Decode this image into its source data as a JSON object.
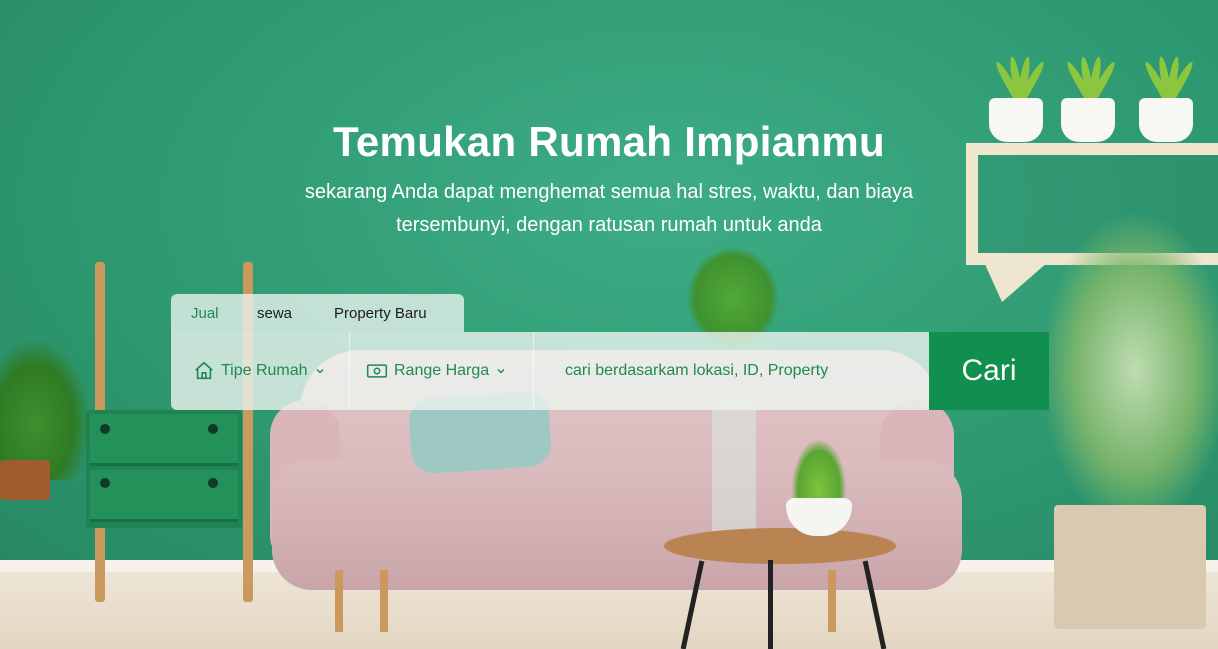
{
  "hero": {
    "title": "Temukan Rumah Impianmu",
    "subtitle_line1": "sekarang Anda dapat menghemat semua hal stres, waktu, dan biaya",
    "subtitle_line2": "tersembunyi, dengan ratusan rumah untuk anda"
  },
  "search": {
    "tabs": [
      {
        "label": "Jual",
        "active": true
      },
      {
        "label": "sewa",
        "active": false
      },
      {
        "label": "Property Baru",
        "active": false
      }
    ],
    "filters": {
      "tipe_rumah": {
        "label": "Tipe Rumah",
        "icon": "home-icon"
      },
      "range_harga": {
        "label": "Range Harga",
        "icon": "money-icon"
      }
    },
    "placeholder": "cari berdasarkam lokasi, ID, Property",
    "button_label": "Cari"
  },
  "colors": {
    "accent": "#118f4f",
    "accent_text": "#1f8a4f",
    "wall": "#2f9a72"
  }
}
